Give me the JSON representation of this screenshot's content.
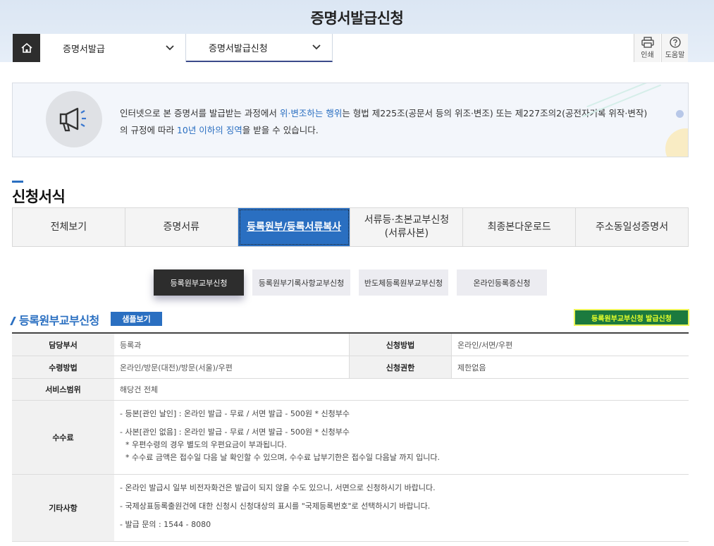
{
  "header": {
    "title": "증명서발급신청"
  },
  "nav": {
    "home_icon": "home-icon",
    "items": [
      {
        "label": "증명서발급"
      },
      {
        "label": "증명서발급신청"
      }
    ],
    "tools": {
      "print_label": "인쇄",
      "help_label": "도움말"
    }
  },
  "notice": {
    "icon": "megaphone-icon",
    "text_1": "인터넷으로 본 증명서를 발급받는 과정에서 ",
    "highlight_1": "위·변조하는 행위",
    "text_2": "는 형법 제225조(공문서 등의 위조·변조) 또는 제227조의2(공전자기록 위작·변작)",
    "text_3": "의 규정에 따라 ",
    "highlight_2": "10년 이하의 징역",
    "text_4": "을 받을 수 있습니다."
  },
  "section": {
    "title": "신청서식"
  },
  "main_tabs": [
    {
      "label": "전체보기"
    },
    {
      "label": "증명서류"
    },
    {
      "label": "등록원부/등록서류복사"
    },
    {
      "label_1": "서류등·초본교부신청",
      "label_2": "(서류사본)"
    },
    {
      "label": "최종본다운로드"
    },
    {
      "label": "주소동일성증명서"
    }
  ],
  "sub_tabs": [
    {
      "label": "등록원부교부신청"
    },
    {
      "label": "등록원부기록사항교부신청"
    },
    {
      "label": "반도체등록원부교부신청"
    },
    {
      "label": "온라인등록증신청"
    }
  ],
  "form": {
    "title": "등록원부교부신청",
    "sample_label": "샘플보기",
    "apply_label": "등록원부교부신청 발급신청"
  },
  "table": {
    "r1": {
      "h1": "담당부서",
      "v1": "등록과",
      "h2": "신청방법",
      "v2": "온라인/서면/우편"
    },
    "r2": {
      "h1": "수령방법",
      "v1": "온라인/방문(대전)/방문(서울)/우편",
      "h2": "신청권한",
      "v2": "제한없음"
    },
    "r3": {
      "h1": "서비스범위",
      "v1": "해당건 전체"
    },
    "r4": {
      "h1": "수수료",
      "lines": [
        "- 등본[관인 날인] : 온라인 발급 - 무료 / 서면 발급 - 500원 * 신청부수",
        "- 사본[관인 없음] : 온라인 발급 - 무료 / 서면 발급 - 500원 * 신청부수",
        "* 우편수령의 경우 별도의 우편요금이 부과됩니다.",
        "* 수수료 금액은 접수일 다음 날 확인할 수 있으며, 수수료 납부기한은 접수일 다음날 까지 입니다."
      ]
    },
    "r5": {
      "h1": "기타사항",
      "lines": [
        "- 온라인 발급시 일부 비전자화건은 발급이 되지 않을 수도 있으니, 서면으로 신청하시기 바랍니다.",
        "- 국제상표등록출원건에 대한 신청시 신청대상의 표시를 \"국제등록번호\"로 선택하시기 바랍니다.",
        "- 발급 문의 : 1544 - 8080"
      ]
    }
  },
  "colors": {
    "accent": "#2a6fc1",
    "apply_button": "#1c7a3e",
    "apply_text": "#e6ff2a",
    "home_bg": "#2d2d2d"
  }
}
